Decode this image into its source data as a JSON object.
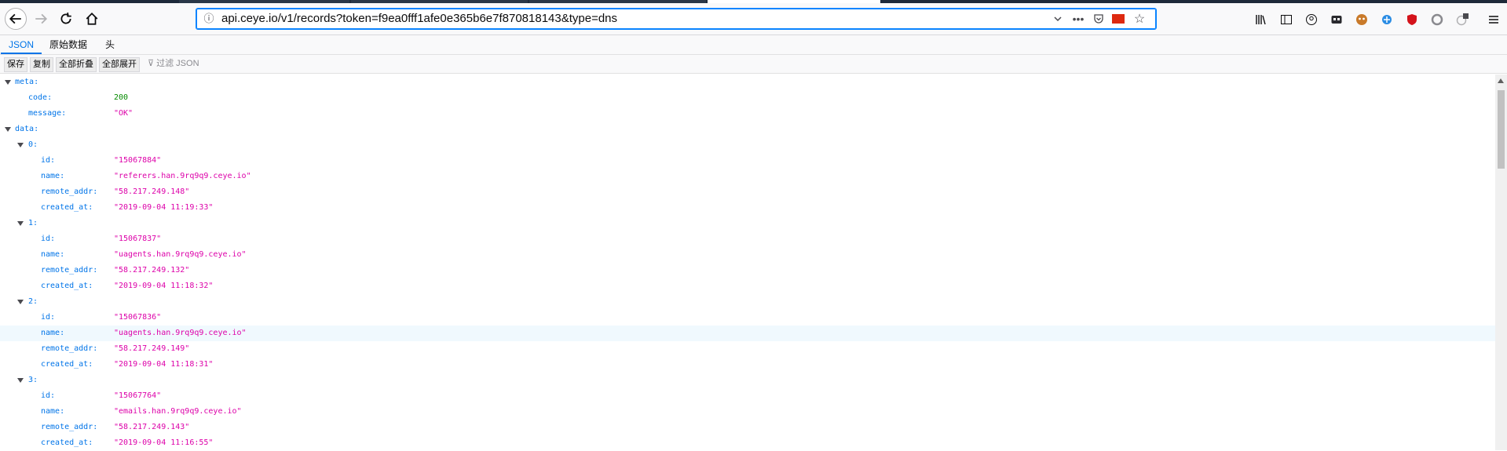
{
  "browser": {
    "url": "api.ceye.io/v1/records?token=f9ea0fff1afe0e365b6e7f870818143&type=dns"
  },
  "viewer_tabs": [
    "JSON",
    "原始数据",
    "头"
  ],
  "toolbar": {
    "save": "保存",
    "copy": "复制",
    "collapse_all": "全部折叠",
    "expand_all": "全部展开",
    "filter_placeholder": "过滤 JSON"
  },
  "json": {
    "meta_key": "meta:",
    "code_key": "code:",
    "code_val": "200",
    "message_key": "message:",
    "message_val": "\"OK\"",
    "data_key": "data:",
    "records": [
      {
        "idx": "0:",
        "id_key": "id:",
        "id": "\"15067884\"",
        "name_key": "name:",
        "name": "\"referers.han.9rq9q9.ceye.io\"",
        "addr_key": "remote_addr:",
        "addr": "\"58.217.249.148\"",
        "created_key": "created_at:",
        "created": "\"2019-09-04 11:19:33\""
      },
      {
        "idx": "1:",
        "id_key": "id:",
        "id": "\"15067837\"",
        "name_key": "name:",
        "name": "\"uagents.han.9rq9q9.ceye.io\"",
        "addr_key": "remote_addr:",
        "addr": "\"58.217.249.132\"",
        "created_key": "created_at:",
        "created": "\"2019-09-04 11:18:32\""
      },
      {
        "idx": "2:",
        "id_key": "id:",
        "id": "\"15067836\"",
        "name_key": "name:",
        "name": "\"uagents.han.9rq9q9.ceye.io\"",
        "addr_key": "remote_addr:",
        "addr": "\"58.217.249.149\"",
        "created_key": "created_at:",
        "created": "\"2019-09-04 11:18:31\""
      },
      {
        "idx": "3:",
        "id_key": "id:",
        "id": "\"15067764\"",
        "name_key": "name:",
        "name": "\"emails.han.9rq9q9.ceye.io\"",
        "addr_key": "remote_addr:",
        "addr": "\"58.217.249.143\"",
        "created_key": "created_at:",
        "created": "\"2019-09-04 11:16:55\""
      }
    ]
  }
}
